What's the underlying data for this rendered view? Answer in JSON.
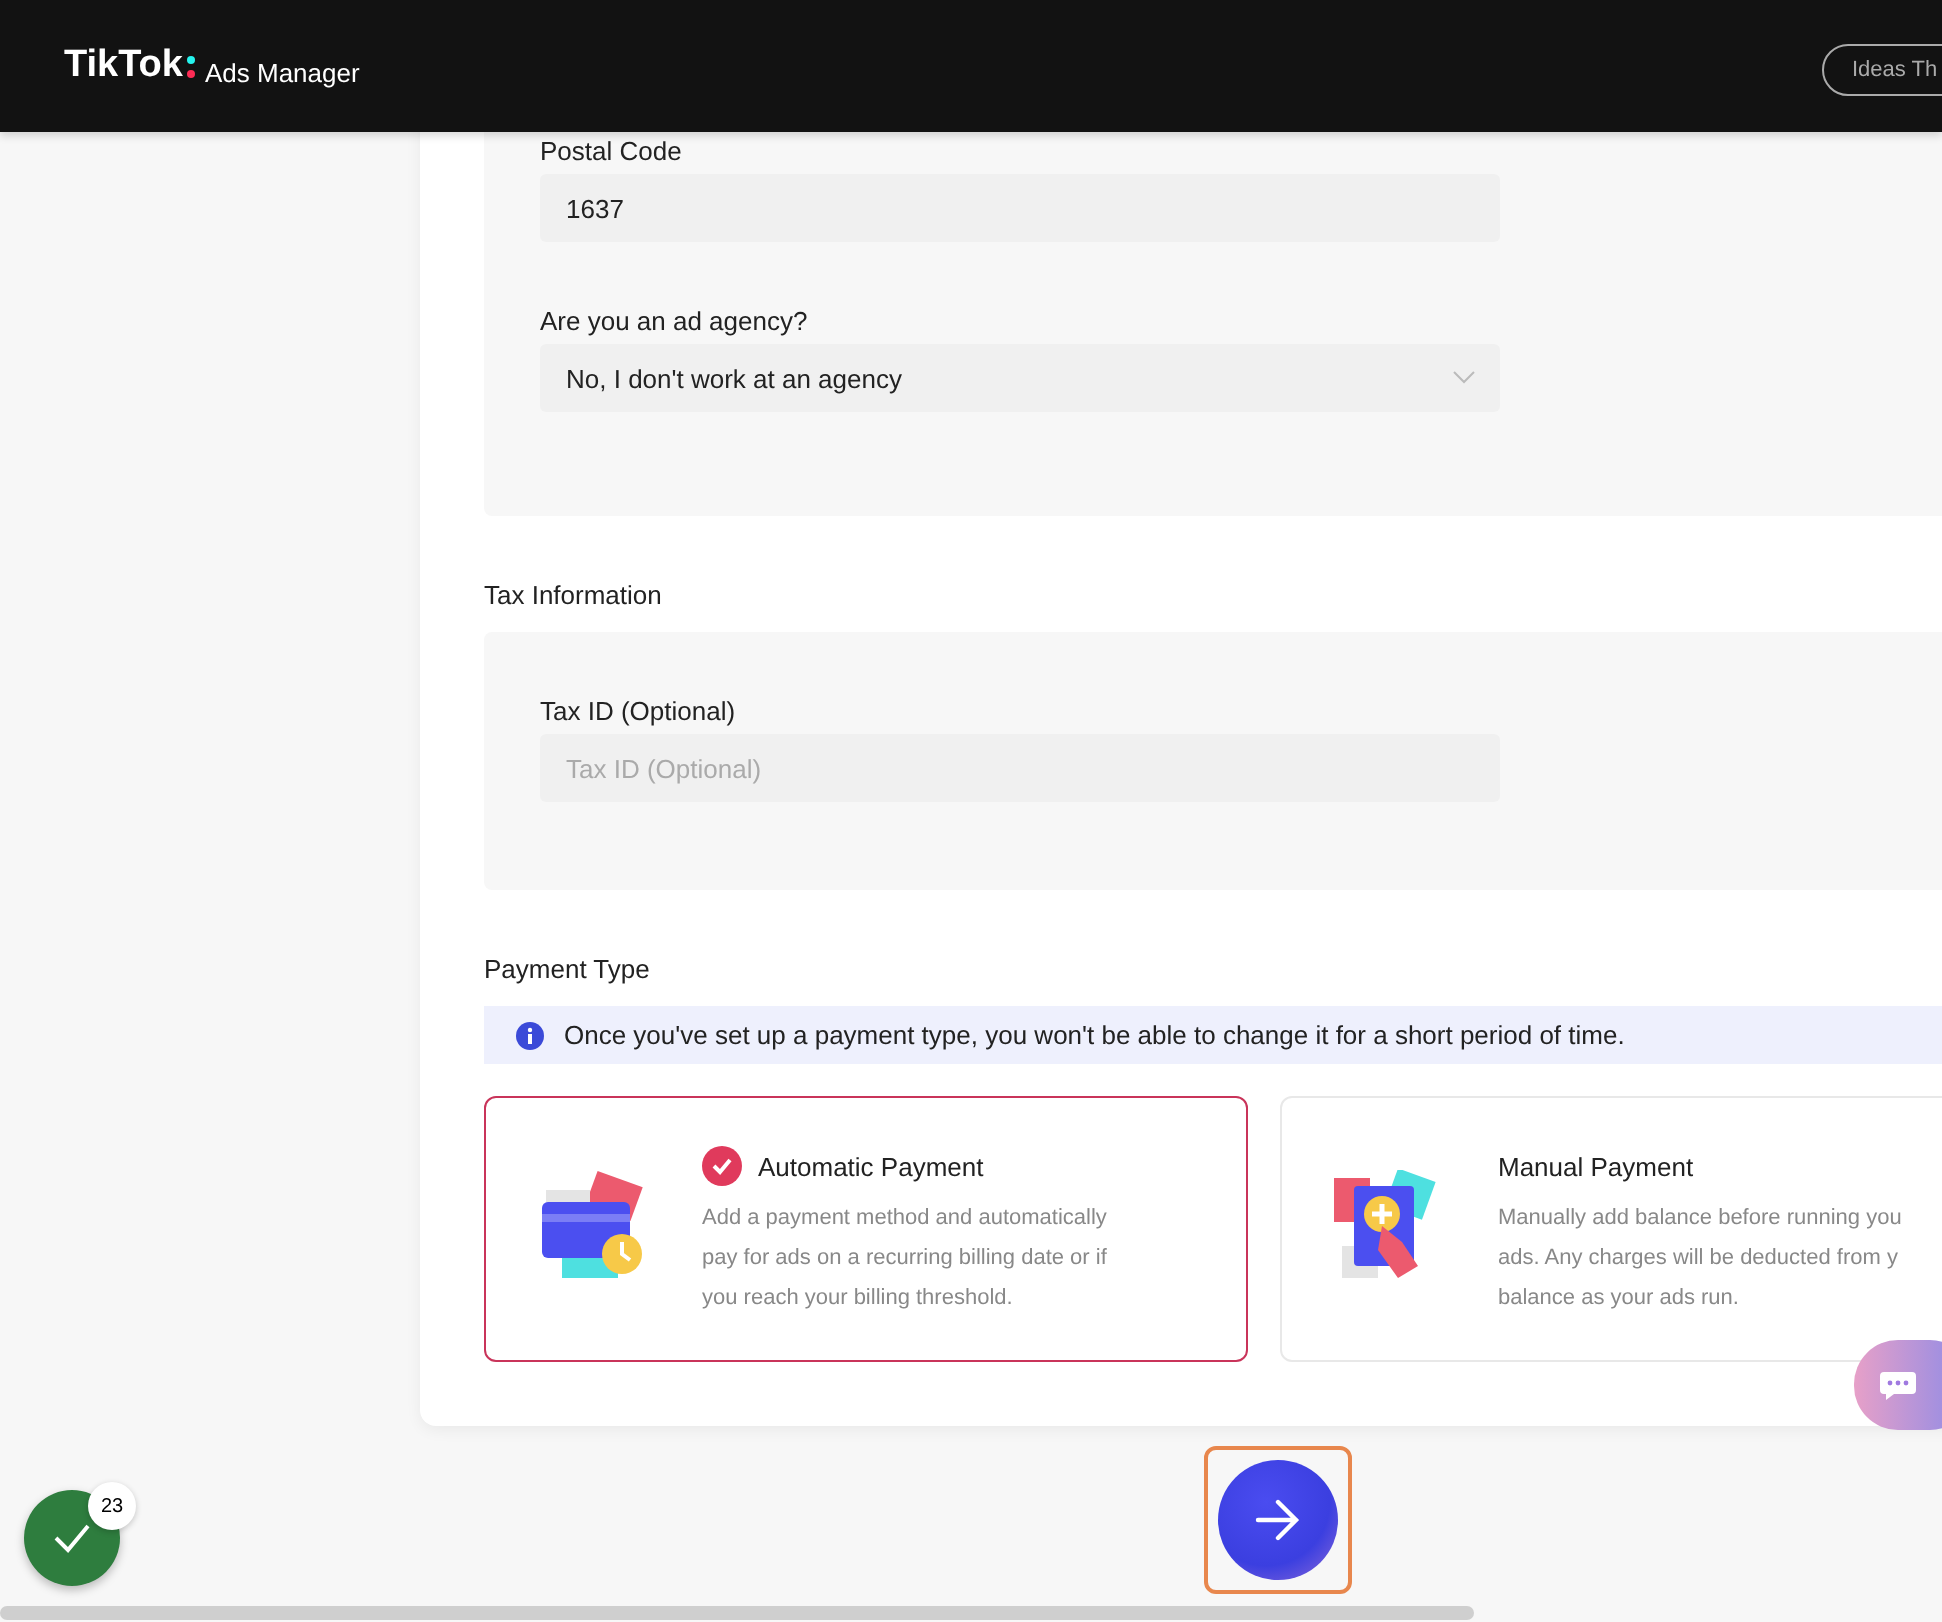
{
  "header": {
    "logo": "TikTok",
    "product": "Ads Manager",
    "button": "Ideas Th"
  },
  "business_section": {
    "fields": [
      {
        "label": "Postal Code",
        "value": "1637",
        "kind": "text"
      },
      {
        "label": "Are you an ad agency?",
        "value": "No, I don't work at an agency",
        "kind": "select"
      }
    ]
  },
  "tax_section": {
    "title": "Tax Information",
    "fields": [
      {
        "label": "Tax ID (Optional)",
        "placeholder": "Tax ID (Optional)",
        "kind": "text"
      }
    ]
  },
  "payment": {
    "title": "Payment Type",
    "notice": "Once you've set up a payment type, you won't be able to change it for a short period of time.",
    "options": [
      {
        "kind": "automatic",
        "title": "Automatic Payment",
        "description": "Add a payment method and automatically pay for ads on a recurring billing date or if you reach your billing threshold.",
        "selected": true
      },
      {
        "kind": "manual",
        "title": "Manual Payment",
        "description": "Manually add balance before running you ads. Any charges will be deducted from y balance as your ads run.",
        "selected": false
      }
    ]
  },
  "task_badge": {
    "count": "23"
  }
}
